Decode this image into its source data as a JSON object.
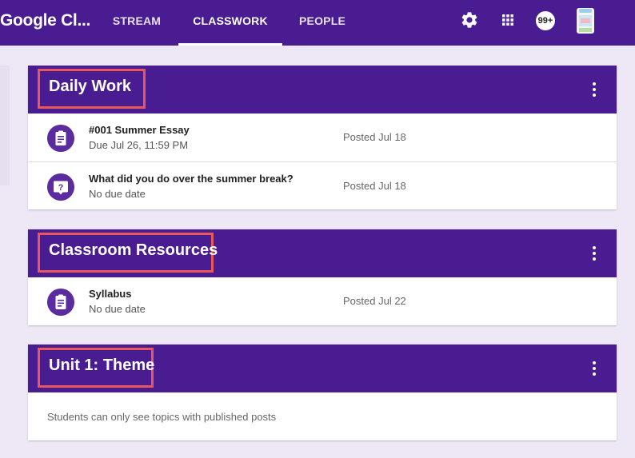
{
  "header": {
    "app_title": "Google Cl...",
    "tabs": [
      {
        "label": "STREAM"
      },
      {
        "label": "CLASSWORK",
        "active": true
      },
      {
        "label": "PEOPLE"
      }
    ],
    "notification_badge": "99+",
    "icons": [
      "gear-icon",
      "apps-grid-icon",
      "notifications-icon",
      "avatar"
    ]
  },
  "topics": [
    {
      "title": "Daily Work",
      "items": [
        {
          "icon": "assignment-icon",
          "title": "#001 Summer Essay",
          "subtitle": "Due Jul 26, 11:59 PM",
          "posted": "Posted Jul 18"
        },
        {
          "icon": "question-icon",
          "title": "What did you do over the summer break?",
          "subtitle": "No due date",
          "posted": "Posted Jul 18"
        }
      ]
    },
    {
      "title": "Classroom Resources",
      "items": [
        {
          "icon": "assignment-icon",
          "title": "Syllabus",
          "subtitle": "No due date",
          "posted": "Posted Jul 22"
        }
      ]
    },
    {
      "title": "Unit 1: Theme",
      "empty_message": "Students can only see topics with published posts"
    }
  ],
  "colors": {
    "header_purple": "#4a1c91",
    "background": "#ede7f6",
    "highlight_border": "#e8585a",
    "icon_purple": "#5b2c9f"
  }
}
